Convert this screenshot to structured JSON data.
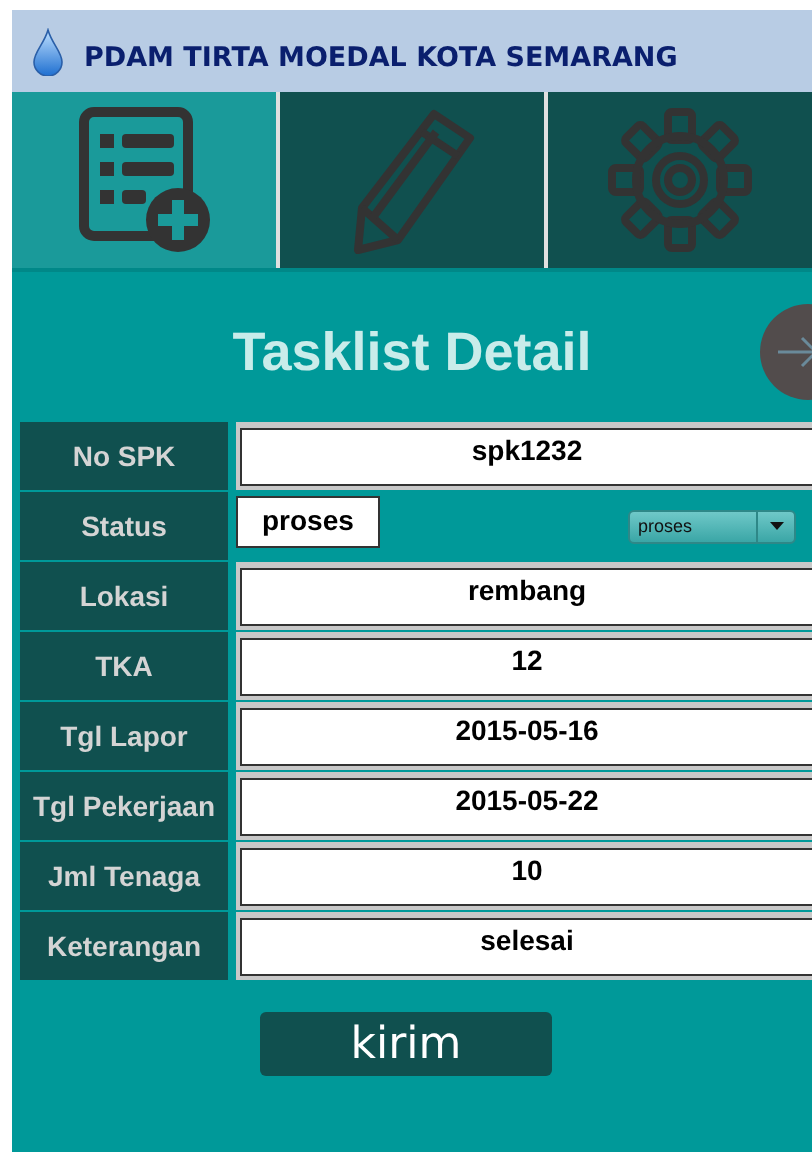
{
  "header": {
    "title": "PDAM TIRTA MOEDAL KOTA SEMARANG"
  },
  "tabs": [
    {
      "kind": "tasklist",
      "selected": true
    },
    {
      "kind": "edit",
      "selected": false
    },
    {
      "kind": "settings",
      "selected": false
    }
  ],
  "page_title": "Tasklist Detail",
  "fields": [
    {
      "kind": "text",
      "label": "No SPK",
      "value": "spk1232"
    },
    {
      "kind": "select",
      "label": "Status",
      "value": "proses",
      "option": "proses"
    },
    {
      "kind": "text",
      "label": "Lokasi",
      "value": "rembang"
    },
    {
      "kind": "text",
      "label": "TKA",
      "value": "12"
    },
    {
      "kind": "text",
      "label": "Tgl Lapor",
      "value": "2015-05-16"
    },
    {
      "kind": "text",
      "label": "Tgl Pekerjaan",
      "value": "2015-05-22"
    },
    {
      "kind": "text",
      "label": "Jml Tenaga",
      "value": "10"
    },
    {
      "kind": "text",
      "label": "Keterangan",
      "value": "selesai"
    }
  ],
  "submit": "kirim"
}
